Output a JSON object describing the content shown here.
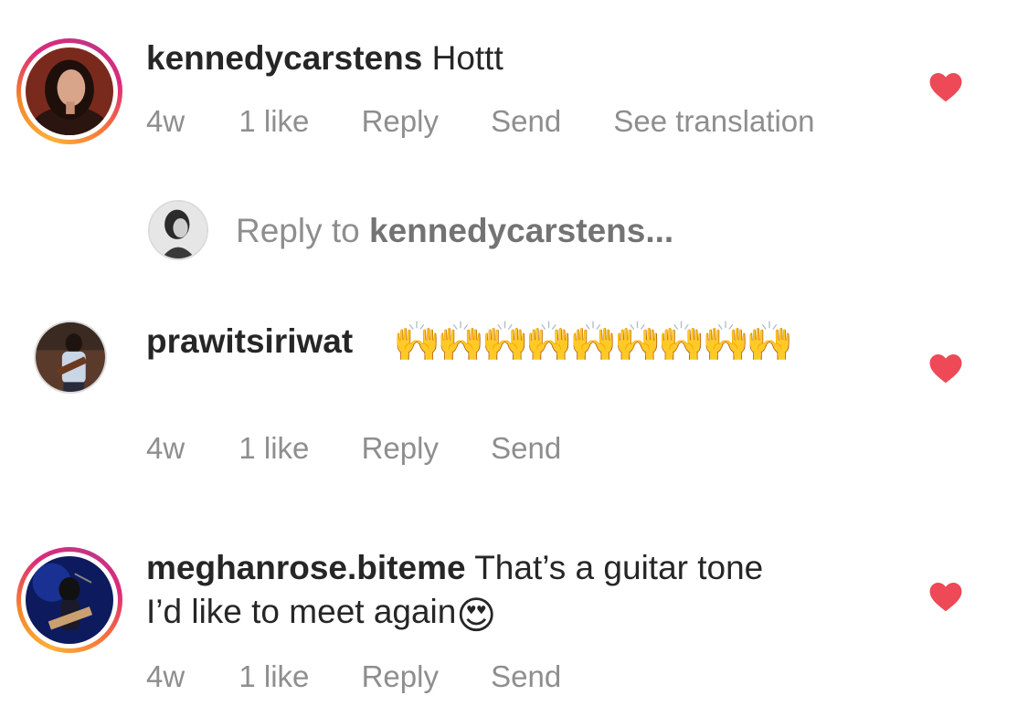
{
  "comments": [
    {
      "username": "kennedycarstens",
      "text": "Hottt",
      "time": "4w",
      "likes": "1 like",
      "reply": "Reply",
      "send": "Send",
      "translate": "See translation",
      "liked": true
    },
    {
      "username": "prawitsiriwat",
      "text": "🙌🙌🙌🙌🙌🙌🙌🙌🙌",
      "time": "4w",
      "likes": "1 like",
      "reply": "Reply",
      "send": "Send",
      "liked": true
    },
    {
      "username": "meghanrose.biteme",
      "text_line1": "That’s a guitar tone",
      "text_line2": "I’d like to meet again",
      "text_emoji": "😍",
      "time": "4w",
      "likes": "1 like",
      "reply": "Reply",
      "send": "Send",
      "liked": true
    }
  ],
  "reply_box": {
    "prefix": "Reply to",
    "target": "kennedycarstens..."
  },
  "colors": {
    "heart": "#ed4956",
    "meta_text": "#8e8e8e",
    "username": "#262626"
  },
  "icons": {
    "like": "heart-icon"
  }
}
